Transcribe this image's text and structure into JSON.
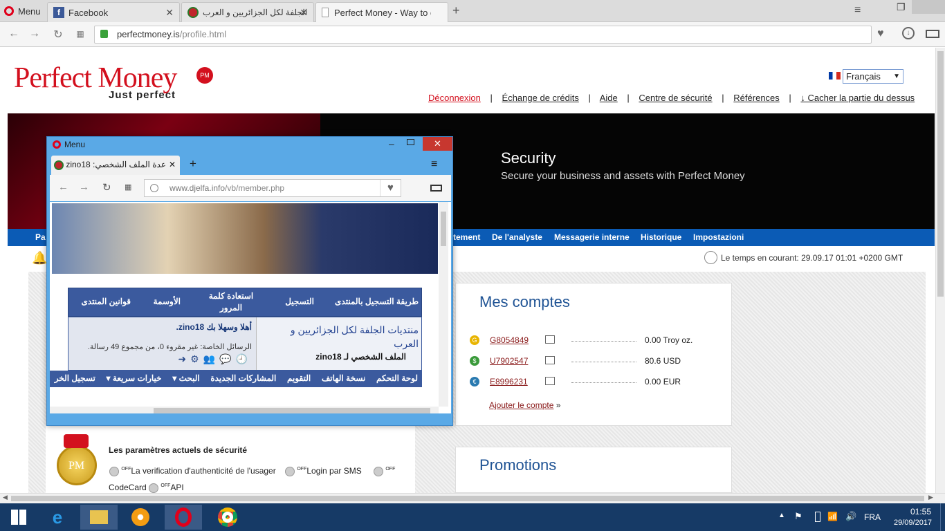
{
  "browser": {
    "menu_label": "Menu",
    "tabs": [
      {
        "label": "Facebook",
        "icon": "facebook-icon"
      },
      {
        "label": "الجلفة لكل الجزائريين و العرب",
        "icon": "djelfa-icon"
      },
      {
        "label": "Perfect Money - Way to do",
        "icon": "pm-icon"
      }
    ],
    "url_host": "perfectmoney.is",
    "url_path": "/profile.html"
  },
  "site": {
    "logo_text": "Perfect Money",
    "logo_badge": "PM",
    "tagline": "Just perfect",
    "language": "Français",
    "top_links": [
      "Déconnexion",
      "Échange de crédits",
      "Aide",
      "Centre de sécurité",
      "Références",
      "↓ Cacher la partie du dessus"
    ],
    "banner_title": "Security",
    "banner_subtitle": "Secure your business and assets with Perfect Money",
    "nav": [
      "Pa",
      "tement",
      "De l'analyste",
      "Messagerie interne",
      "Historique",
      "Impostazioni"
    ],
    "time_label": "Le temps en courant: 29.09.17 01:01 +0200 GMT",
    "accounts_title": "Mes comptes",
    "accounts": [
      {
        "id": "G8054849",
        "balance": "0.00 Troy oz.",
        "color": "#e8b400",
        "symbol": "G"
      },
      {
        "id": "U7902547",
        "balance": "80.6 USD",
        "color": "#3a9a3a",
        "symbol": "$"
      },
      {
        "id": "E8996231",
        "balance": "0.00 EUR",
        "color": "#2a7ab0",
        "symbol": "€"
      }
    ],
    "add_account": "Ajouter le compte",
    "promotions_title": "Promotions",
    "security_title": "Les paramètres actuels de sécurité",
    "security_items": [
      "La verification d'authenticité de l'usager",
      "Login par SMS",
      "CodeCard",
      "API"
    ],
    "off_label": "OFF",
    "medal_text": "PM"
  },
  "popup": {
    "menu_label": "Menu",
    "tab_label": "zino18 :عدة الملف الشخصي",
    "url_host": "www.djelfa.info",
    "url_path": "/vb/member.php",
    "forum_links": [
      "طريقة التسجيل بالمنتدى",
      "التسجيل",
      "استعادة كلمة المرور",
      "الأوسمة",
      "قوانين المنتدى"
    ],
    "forum_name": "منتديات الجلفة لكل الجزائريين و العرب",
    "profile_crumb": "الملف الشخصي لـ zino18",
    "welcome": "أهلا وسهلا بك zino18.",
    "pm_line": "الرسائل الخاصة: غير مقروء 0، من مجموع 49 رسالة.",
    "bottom_nav": [
      "لوحة التحكم",
      "نسخة الهاتف",
      "التقويم",
      "المشاركات الجديدة",
      "البحث ▾",
      "خيارات سريعة ▾",
      "تسجيل الخر"
    ]
  },
  "taskbar": {
    "lang": "FRA",
    "time": "01:55",
    "date": "29/09/2017"
  }
}
